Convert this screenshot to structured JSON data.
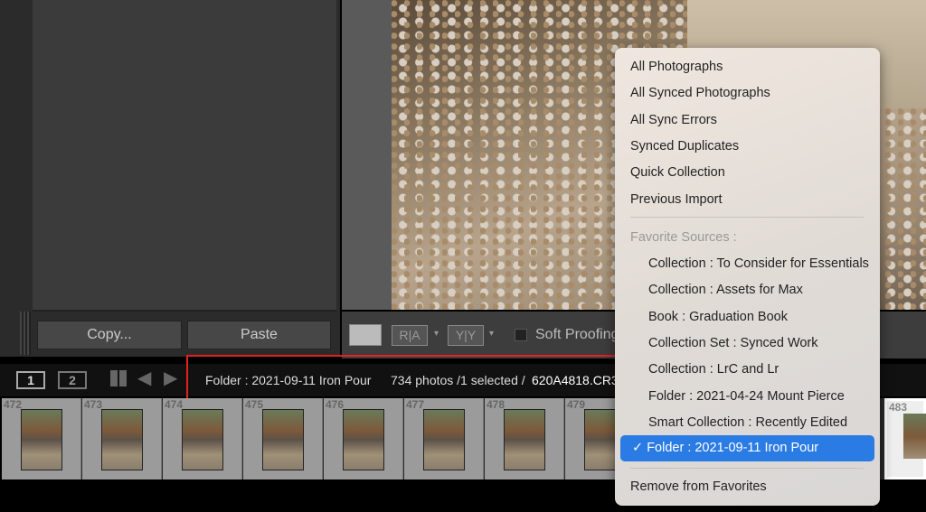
{
  "left_panel": {
    "copy_label": "Copy...",
    "paste_label": "Paste"
  },
  "toolbar": {
    "soft_proofing_label": "Soft Proofing",
    "soft_proofing_checked": false,
    "icons": [
      "loupe-view-icon",
      "before-after-ra-icon",
      "before-after-yy-icon"
    ]
  },
  "filmstrip": {
    "pages": [
      "1",
      "2"
    ],
    "source": "Folder : 2021-09-11 Iron Pour",
    "count_text": "734 photos /1 selected /",
    "filename": "620A4818.CR3",
    "thumbnails": [
      "472",
      "473",
      "474",
      "475",
      "476",
      "477",
      "478",
      "479"
    ],
    "right_thumbnail": "483"
  },
  "menu": {
    "items": [
      "All Photographs",
      "All Synced Photographs",
      "All Sync Errors",
      "Synced Duplicates",
      "Quick Collection",
      "Previous Import"
    ],
    "favorites_header": "Favorite Sources :",
    "favorites": [
      "Collection : To Consider for Essentials",
      "Collection : Assets for Max",
      "Book : Graduation Book",
      "Collection Set : Synced Work",
      "Collection : LrC and Lr",
      "Folder : 2021-04-24 Mount Pierce",
      "Smart Collection : Recently Edited"
    ],
    "selected": "Folder : 2021-09-11 Iron Pour",
    "remove": "Remove from Favorites",
    "accent": "#2a7be4"
  },
  "highlight_color": "#e52020"
}
